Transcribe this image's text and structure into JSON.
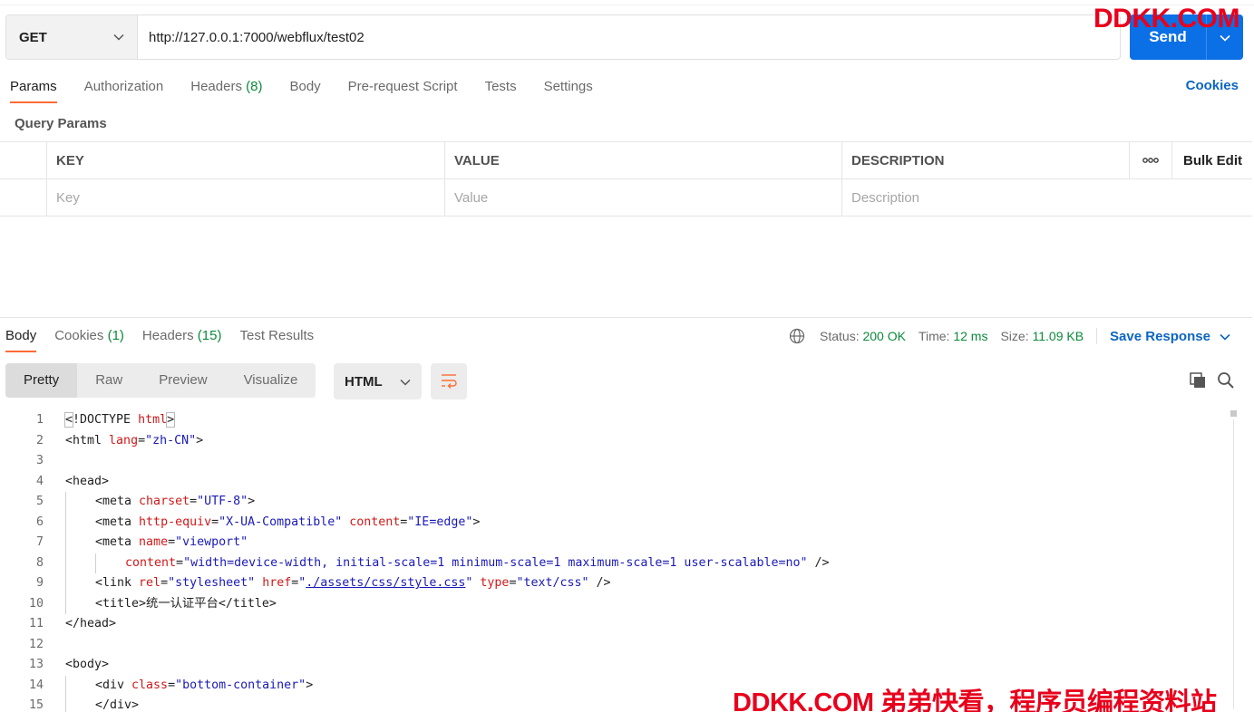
{
  "request": {
    "method": "GET",
    "url": "http://127.0.0.1:7000/webflux/test02",
    "send_label": "Send"
  },
  "watermark_top": "DDKK.COM",
  "watermark_bottom": "DDKK.COM 弟弟快看，程序员编程资料站",
  "request_tabs": [
    {
      "label": "Params",
      "count": ""
    },
    {
      "label": "Authorization",
      "count": ""
    },
    {
      "label": "Headers",
      "count": "(8)"
    },
    {
      "label": "Body",
      "count": ""
    },
    {
      "label": "Pre-request Script",
      "count": ""
    },
    {
      "label": "Tests",
      "count": ""
    },
    {
      "label": "Settings",
      "count": ""
    }
  ],
  "cookies_link": "Cookies",
  "query_params": {
    "title": "Query Params",
    "headers": {
      "key": "KEY",
      "value": "VALUE",
      "description": "DESCRIPTION",
      "bulk_edit": "Bulk Edit"
    },
    "placeholders": {
      "key": "Key",
      "value": "Value",
      "description": "Description"
    }
  },
  "response_tabs": [
    {
      "label": "Body",
      "count": ""
    },
    {
      "label": "Cookies",
      "count": "(1)"
    },
    {
      "label": "Headers",
      "count": "(15)"
    },
    {
      "label": "Test Results",
      "count": ""
    }
  ],
  "response_status": {
    "status_label": "Status:",
    "status_value": "200 OK",
    "time_label": "Time:",
    "time_value": "12 ms",
    "size_label": "Size:",
    "size_value": "11.09 KB",
    "save_response": "Save Response"
  },
  "format_buttons": [
    "Pretty",
    "Raw",
    "Preview",
    "Visualize"
  ],
  "language": "HTML",
  "code_lines": [
    {
      "n": "1",
      "indent": 0,
      "tokens": [
        [
          "b",
          "<"
        ],
        [
          "tg",
          "!DOCTYPE "
        ],
        [
          "an",
          "html"
        ],
        [
          "b",
          ">"
        ]
      ]
    },
    {
      "n": "2",
      "indent": 0,
      "tokens": [
        [
          "tg",
          "<html "
        ],
        [
          "an",
          "lang"
        ],
        [
          "tg",
          "="
        ],
        [
          "av",
          "\"zh-CN\""
        ],
        [
          "tg",
          ">"
        ]
      ]
    },
    {
      "n": "3",
      "indent": 0,
      "tokens": []
    },
    {
      "n": "4",
      "indent": 0,
      "tokens": [
        [
          "tg",
          "<head>"
        ]
      ]
    },
    {
      "n": "5",
      "indent": 1,
      "tokens": [
        [
          "tg",
          "<meta "
        ],
        [
          "an",
          "charset"
        ],
        [
          "tg",
          "="
        ],
        [
          "av",
          "\"UTF-8\""
        ],
        [
          "tg",
          ">"
        ]
      ]
    },
    {
      "n": "6",
      "indent": 1,
      "tokens": [
        [
          "tg",
          "<meta "
        ],
        [
          "an",
          "http-equiv"
        ],
        [
          "tg",
          "="
        ],
        [
          "av",
          "\"X-UA-Compatible\""
        ],
        [
          "tg",
          " "
        ],
        [
          "an",
          "content"
        ],
        [
          "tg",
          "="
        ],
        [
          "av",
          "\"IE=edge\""
        ],
        [
          "tg",
          ">"
        ]
      ]
    },
    {
      "n": "7",
      "indent": 1,
      "tokens": [
        [
          "tg",
          "<meta "
        ],
        [
          "an",
          "name"
        ],
        [
          "tg",
          "="
        ],
        [
          "av",
          "\"viewport\""
        ]
      ]
    },
    {
      "n": "8",
      "indent": 2,
      "tokens": [
        [
          "an",
          "content"
        ],
        [
          "tg",
          "="
        ],
        [
          "av",
          "\"width=device-width, initial-scale=1 minimum-scale=1 maximum-scale=1 user-scalable=no\""
        ],
        [
          "tg",
          " />"
        ]
      ]
    },
    {
      "n": "9",
      "indent": 1,
      "tokens": [
        [
          "tg",
          "<link "
        ],
        [
          "an",
          "rel"
        ],
        [
          "tg",
          "="
        ],
        [
          "av",
          "\"stylesheet\""
        ],
        [
          "tg",
          " "
        ],
        [
          "an",
          "href"
        ],
        [
          "tg",
          "="
        ],
        [
          "av",
          "\""
        ],
        [
          "avu",
          "./assets/css/style.css"
        ],
        [
          "av",
          "\""
        ],
        [
          "tg",
          " "
        ],
        [
          "an",
          "type"
        ],
        [
          "tg",
          "="
        ],
        [
          "av",
          "\"text/css\""
        ],
        [
          "tg",
          " />"
        ]
      ]
    },
    {
      "n": "10",
      "indent": 1,
      "tokens": [
        [
          "tg",
          "<title>统一认证平台</title>"
        ]
      ]
    },
    {
      "n": "11",
      "indent": 0,
      "tokens": [
        [
          "tg",
          "</head>"
        ]
      ]
    },
    {
      "n": "12",
      "indent": 0,
      "tokens": []
    },
    {
      "n": "13",
      "indent": 0,
      "tokens": [
        [
          "tg",
          "<body>"
        ]
      ]
    },
    {
      "n": "14",
      "indent": 1,
      "tokens": [
        [
          "tg",
          "<div "
        ],
        [
          "an",
          "class"
        ],
        [
          "tg",
          "="
        ],
        [
          "av",
          "\"bottom-container\""
        ],
        [
          "tg",
          ">"
        ]
      ]
    },
    {
      "n": "15",
      "indent": 1,
      "tokens": [
        [
          "tg",
          "</div>"
        ]
      ]
    }
  ],
  "colors": {
    "accent": "#ff6c37",
    "send": "#0b6fe6",
    "link": "#0b66c3",
    "success": "#0a8a3a",
    "watermark": "#e8001c"
  },
  "icons": [
    "chevron-down-icon",
    "more-dots-icon",
    "globe-icon",
    "wrap-lines-icon",
    "copy-icon",
    "search-icon"
  ]
}
